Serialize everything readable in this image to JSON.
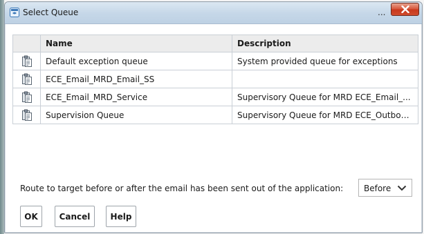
{
  "window": {
    "title": "Select Queue",
    "ellipsis": "..."
  },
  "table": {
    "columns": [
      "Name",
      "Description"
    ],
    "rows": [
      {
        "name": "Default exception queue",
        "description": "System provided queue for exceptions"
      },
      {
        "name": "ECE_Email_MRD_Email_SS",
        "description": ""
      },
      {
        "name": "ECE_Email_MRD_Service",
        "description": "Supervisory Queue for MRD ECE_Email_..."
      },
      {
        "name": "Supervision Queue",
        "description": "Supervisory Queue for MRD ECE_Outbou..."
      }
    ]
  },
  "route": {
    "label": "Route to target before or after the email has been sent out of the application:",
    "selected": "Before"
  },
  "buttons": {
    "ok": "OK",
    "cancel": "Cancel",
    "help": "Help"
  },
  "icons": {
    "app": "app-window-icon",
    "row": "queue-clipboard-icon",
    "close": "close-icon",
    "dropdown": "chevron-down-icon"
  },
  "colors": {
    "close_button": "#d7563a",
    "header_bg": "#ececec",
    "titlebar": "#c5d7e8"
  }
}
